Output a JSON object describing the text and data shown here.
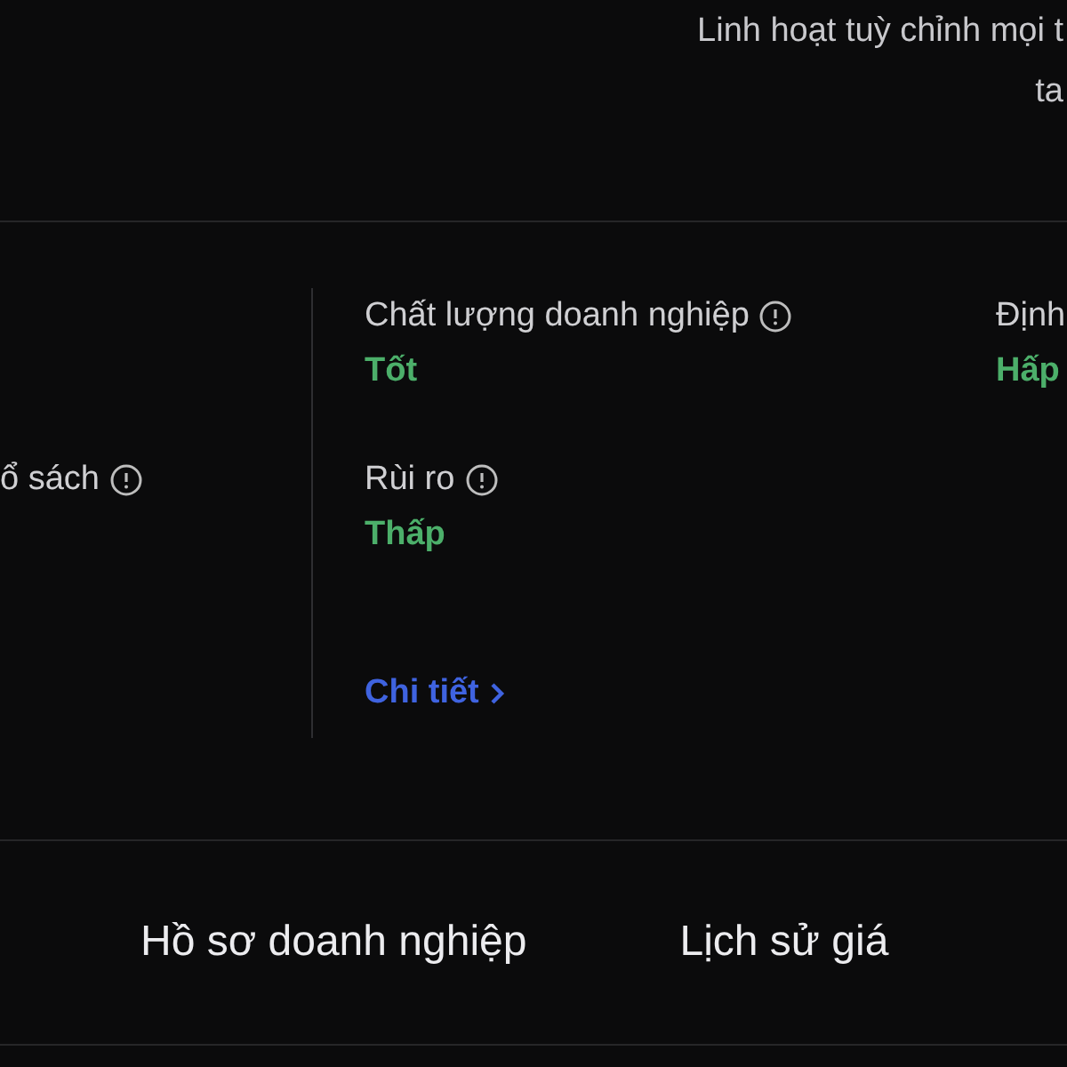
{
  "header": {
    "description_lines": [
      "Linh hoạt tuỳ chỉnh mọi t",
      "ta"
    ]
  },
  "metrics": [
    {
      "label": "ổ sách",
      "info": true
    },
    {
      "label": "Chất lượng doanh nghiệp",
      "info": true,
      "value": "Tốt"
    },
    {
      "label": "Rùi ro",
      "info": true,
      "value": "Thấp"
    },
    {
      "label": "Định",
      "info": false,
      "value": "Hấp"
    }
  ],
  "detail_link": "Chi tiết",
  "tabs": [
    {
      "label": "Hồ sơ doanh nghiệp"
    },
    {
      "label": "Lịch sử giá"
    }
  ]
}
